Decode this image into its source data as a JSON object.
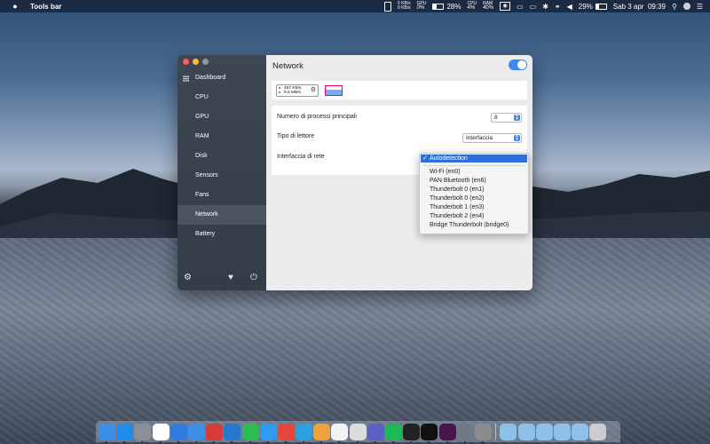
{
  "menubar": {
    "app_name": "Tools bar",
    "net_up": "0 KB/s",
    "net_down": "0 KB/s",
    "gpu_label": "GPU",
    "gpu_value": "0%",
    "battery_percent_mini": "28%",
    "cpu_label": "CPU",
    "cpu_value": "4%",
    "ram_label": "RAM",
    "ram_value": "40%",
    "battery_percent": "29%",
    "date": "Sab 3 apr",
    "time": "09:39"
  },
  "sidebar": {
    "items": [
      {
        "label": "Dashboard",
        "active": false
      },
      {
        "label": "CPU",
        "active": false
      },
      {
        "label": "GPU",
        "active": false
      },
      {
        "label": "RAM",
        "active": false
      },
      {
        "label": "Disk",
        "active": false
      },
      {
        "label": "Sensors",
        "active": false
      },
      {
        "label": "Fans",
        "active": false
      },
      {
        "label": "Network",
        "active": true
      },
      {
        "label": "Battery",
        "active": false
      }
    ]
  },
  "main": {
    "title": "Network",
    "enabled": true,
    "preview": {
      "upload": "467 KB/s",
      "download": "8.5 MB/s"
    },
    "settings": {
      "processes_label": "Numero di processi principali",
      "processes_value": "8",
      "reader_label": "Tipo di lettore",
      "reader_value": "Interfaccia",
      "interface_label": "Interfaccia di rete"
    }
  },
  "dropdown": {
    "selected": "Autodetection",
    "options": [
      "Wi-Fi (en0)",
      "PAN Bluetooth (en6)",
      "Thunderbolt 0 (en1)",
      "Thunderbolt 0 (en2)",
      "Thunderbolt 1 (en3)",
      "Thunderbolt 2 (en4)",
      "Bridge Thunderbolt (bridge0)"
    ]
  },
  "dock": {
    "apps": [
      {
        "name": "finder-icon",
        "color": "#3a8ee8"
      },
      {
        "name": "app-store-icon",
        "color": "#1f8df0"
      },
      {
        "name": "launchpad-icon",
        "color": "#8a8f99"
      },
      {
        "name": "calendar-icon",
        "color": "#ffffff"
      },
      {
        "name": "xcode-icon",
        "color": "#2f7be0"
      },
      {
        "name": "xcode-instruments-icon",
        "color": "#3c8fe6"
      },
      {
        "name": "magnet-icon",
        "color": "#d83a3a"
      },
      {
        "name": "vscode-icon",
        "color": "#2479cf"
      },
      {
        "name": "whatsapp-icon",
        "color": "#2bbd4f"
      },
      {
        "name": "safari-icon",
        "color": "#2f9af2"
      },
      {
        "name": "chrome-icon",
        "color": "#e9453b"
      },
      {
        "name": "telegram-icon",
        "color": "#2aa0e0"
      },
      {
        "name": "scripts-icon",
        "color": "#f0a23a"
      },
      {
        "name": "textedit-icon",
        "color": "#f2f2f2"
      },
      {
        "name": "utility-icon",
        "color": "#dcdcdc"
      },
      {
        "name": "teams-icon",
        "color": "#5b5fc7"
      },
      {
        "name": "spotify-icon",
        "color": "#1db954"
      },
      {
        "name": "activity-monitor-icon",
        "color": "#222222"
      },
      {
        "name": "terminal-icon",
        "color": "#111111"
      },
      {
        "name": "slack-icon",
        "color": "#4a154b"
      },
      {
        "name": "disk-utility-icon",
        "color": "#6f7a85"
      },
      {
        "name": "system-preferences-icon",
        "color": "#8c8c8c"
      },
      {
        "name": "folder-icon-1",
        "color": "#8ec1ea"
      },
      {
        "name": "folder-icon-2",
        "color": "#8ec1ea"
      },
      {
        "name": "folder-icon-3",
        "color": "#8ec1ea"
      },
      {
        "name": "folder-icon-4",
        "color": "#8ec1ea"
      },
      {
        "name": "folder-icon-5",
        "color": "#8ec1ea"
      },
      {
        "name": "trash-icon",
        "color": "#c9ccd1"
      }
    ]
  }
}
